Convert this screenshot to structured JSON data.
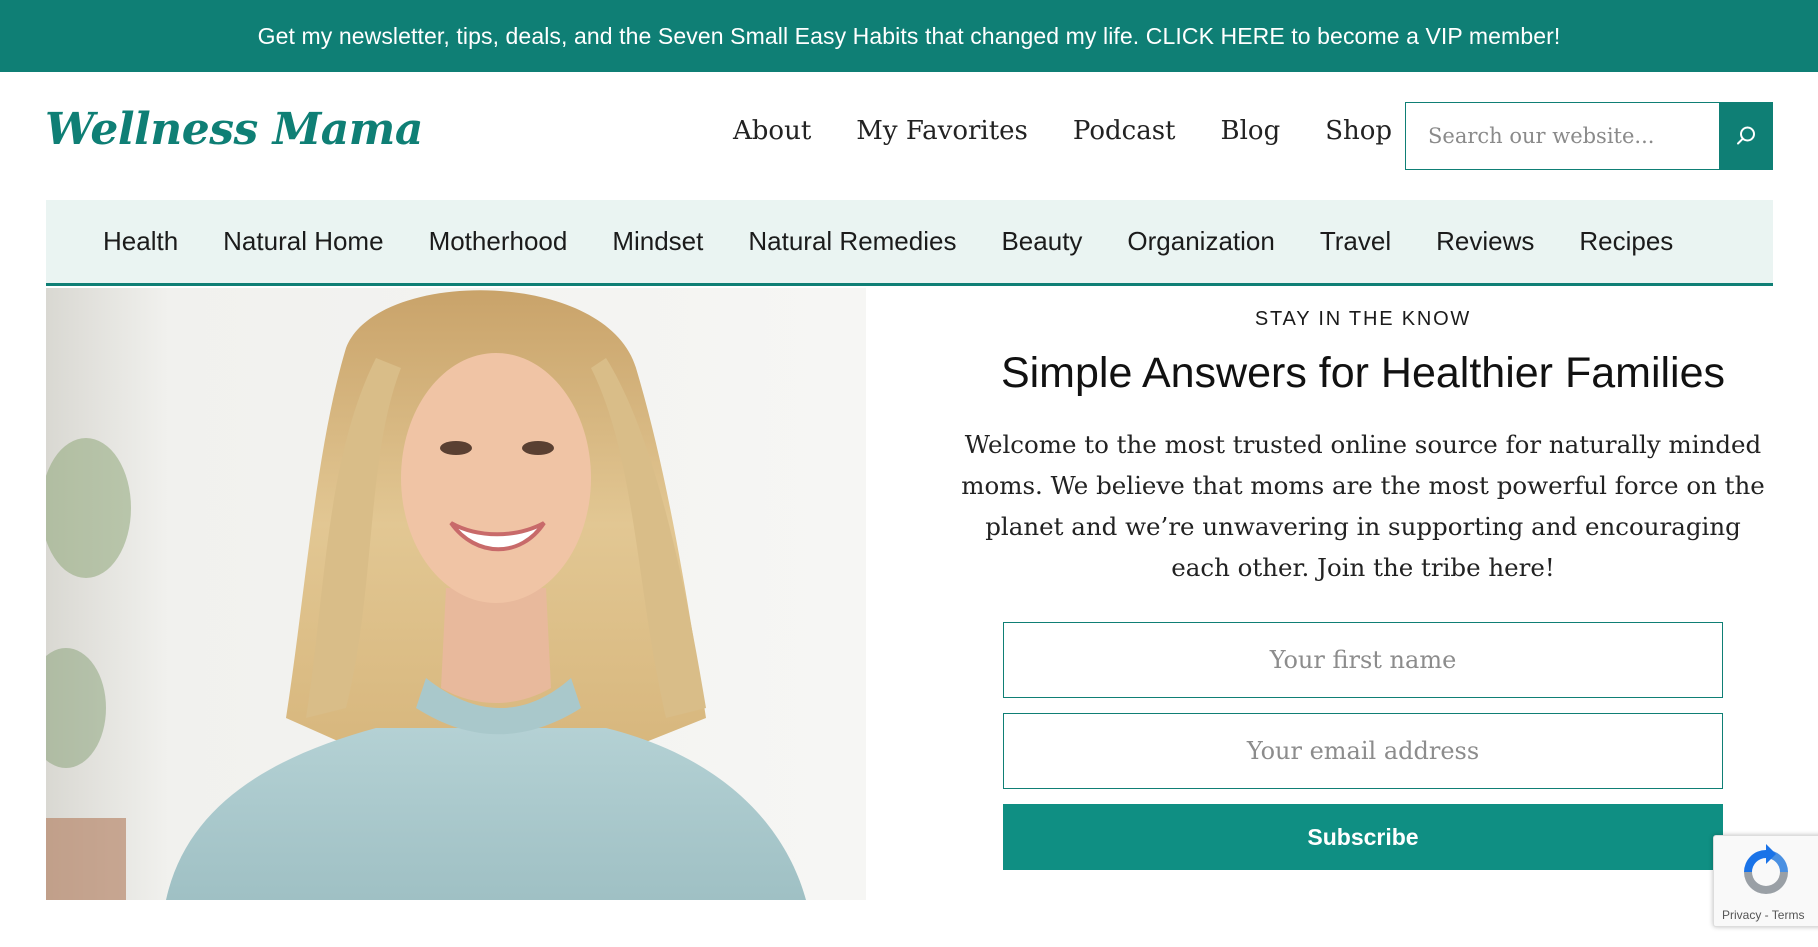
{
  "banner": {
    "text": "Get my newsletter, tips, deals, and the Seven Small Easy Habits that changed my life. CLICK HERE to become a VIP member!"
  },
  "header": {
    "logo_text": "Wellness Mama",
    "nav": [
      {
        "label": "About"
      },
      {
        "label": "My Favorites"
      },
      {
        "label": "Podcast"
      },
      {
        "label": "Blog"
      },
      {
        "label": "Shop"
      }
    ],
    "search": {
      "placeholder": "Search our website...",
      "icon": "search-icon"
    }
  },
  "categories": [
    {
      "label": "Health"
    },
    {
      "label": "Natural Home"
    },
    {
      "label": "Motherhood"
    },
    {
      "label": "Mindset"
    },
    {
      "label": "Natural Remedies"
    },
    {
      "label": "Beauty"
    },
    {
      "label": "Organization"
    },
    {
      "label": "Travel"
    },
    {
      "label": "Reviews"
    },
    {
      "label": "Recipes"
    }
  ],
  "signup": {
    "eyebrow": "STAY IN THE KNOW",
    "headline": "Simple Answers for Healthier Families",
    "intro": "Welcome to the most trusted online source for naturally minded moms. We believe that moms are the most powerful force on the planet and we’re unwavering in supporting and encouraging each other. Join the tribe here!",
    "first_name_placeholder": "Your first name",
    "email_placeholder": "Your email address",
    "subscribe_label": "Subscribe"
  },
  "recaptcha": {
    "privacy": "Privacy",
    "separator": " - ",
    "terms": "Terms"
  },
  "colors": {
    "brand_teal": "#0f7f75",
    "button_teal": "#0f8f83",
    "nav_background": "#eaf4f2"
  }
}
